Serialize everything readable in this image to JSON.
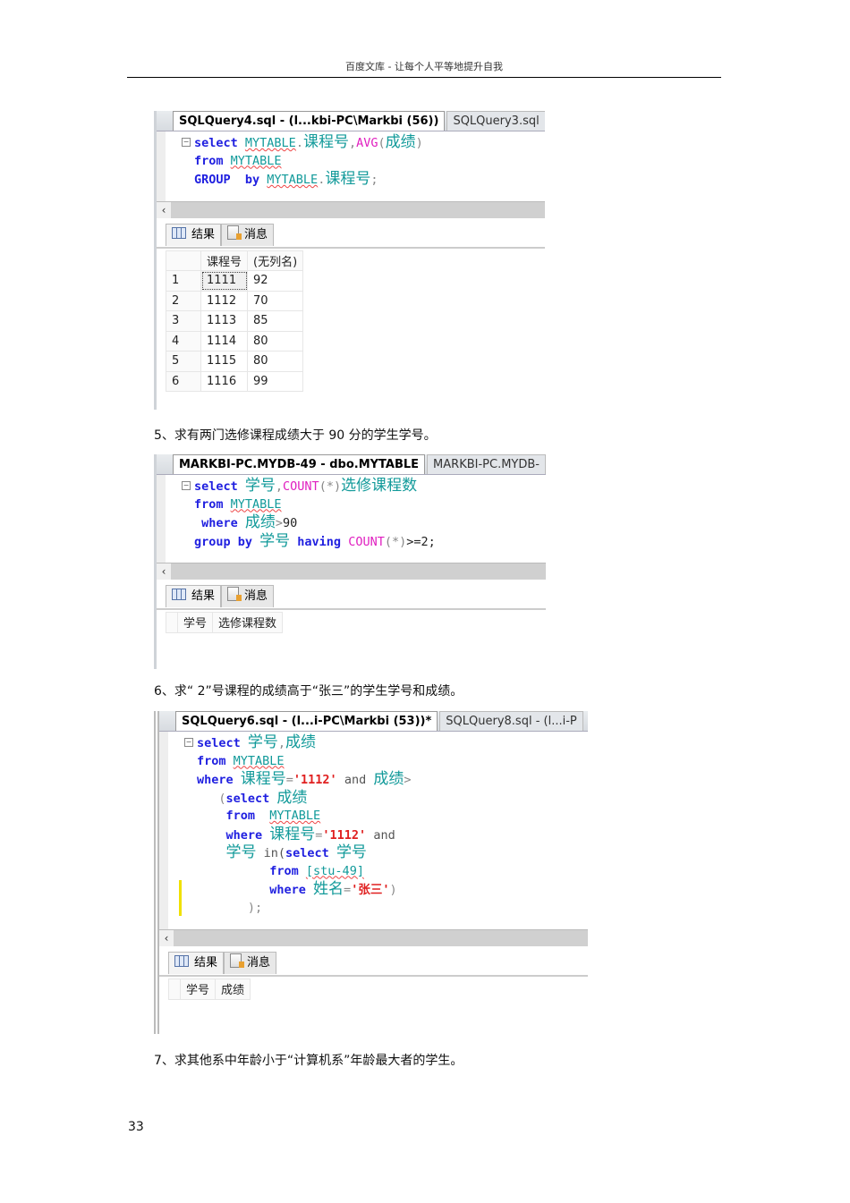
{
  "header": {
    "text": "百度文库  - 让每个人平等地提升自我"
  },
  "page_number": "33",
  "captions": [
    "5、求有两门选修课程成绩大于      90 分的学生学号。",
    "6、求“ 2”号课程的成绩高于“张三”的学生学号和成绩。",
    "7、求其他系中年龄小于“计算机系”年龄最大者的学生。"
  ],
  "shots": [
    {
      "tabs": [
        "SQLQuery4.sql - (l...kbi-PC\\Markbi (56))",
        "SQLQuery3.sql"
      ],
      "code": [
        [
          [
            "kw",
            "select "
          ],
          [
            "id",
            "MYTABLE"
          ],
          [
            "op",
            "."
          ],
          [
            "cn",
            "课程号"
          ],
          [
            "op",
            ","
          ],
          [
            "fn",
            "AVG"
          ],
          [
            "op",
            "("
          ],
          [
            "cn",
            "成绩"
          ],
          [
            "op",
            ")"
          ]
        ],
        [
          [
            "kw",
            "from "
          ],
          [
            "id",
            "MYTABLE"
          ]
        ],
        [
          [
            "kw",
            "GROUP  by "
          ],
          [
            "id",
            "MYTABLE"
          ],
          [
            "op",
            "."
          ],
          [
            "cn",
            "课程号"
          ],
          [
            "op",
            ";"
          ]
        ]
      ],
      "result_tabs": [
        "结果",
        "消息"
      ],
      "columns": [
        "课程号",
        "(无列名)"
      ],
      "rows": [
        [
          "1",
          "1111",
          "92"
        ],
        [
          "2",
          "1112",
          "70"
        ],
        [
          "3",
          "1113",
          "85"
        ],
        [
          "4",
          "1114",
          "80"
        ],
        [
          "5",
          "1115",
          "80"
        ],
        [
          "6",
          "1116",
          "99"
        ]
      ]
    },
    {
      "tabs": [
        "MARKBI-PC.MYDB-49 - dbo.MYTABLE",
        "MARKBI-PC.MYDB-"
      ],
      "code": [
        [
          [
            "kw",
            "select "
          ],
          [
            "cn",
            "学号"
          ],
          [
            "op",
            ","
          ],
          [
            "fn",
            "COUNT"
          ],
          [
            "op",
            "(*)"
          ],
          [
            "cn",
            "选修课程数"
          ]
        ],
        [
          [
            "kw",
            "from "
          ],
          [
            "id",
            "MYTABLE"
          ]
        ],
        [
          [
            "kw",
            " where "
          ],
          [
            "cn",
            "成绩"
          ],
          [
            "op",
            ">"
          ],
          [
            "num",
            "90"
          ]
        ],
        [
          [
            "kw",
            "group by "
          ],
          [
            "cn",
            "学号"
          ],
          [
            "kw",
            " having "
          ],
          [
            "fn",
            "COUNT"
          ],
          [
            "op",
            "(*)"
          ],
          [
            "num",
            ">=2;"
          ]
        ]
      ],
      "result_tabs": [
        "结果",
        "消息"
      ],
      "columns": [
        "学号",
        "选修课程数"
      ],
      "rows": []
    },
    {
      "tabs": [
        "SQLQuery6.sql - (l...i-PC\\Markbi (53))*",
        "SQLQuery8.sql - (l...i-P"
      ],
      "code": [
        [
          [
            "kw",
            "select "
          ],
          [
            "cn",
            "学号"
          ],
          [
            "op",
            ","
          ],
          [
            "cn",
            "成绩"
          ]
        ],
        [
          [
            "kw",
            "from "
          ],
          [
            "id",
            "MYTABLE"
          ]
        ],
        [
          [
            "kw",
            "where "
          ],
          [
            "cn",
            "课程号"
          ],
          [
            "op",
            "="
          ],
          [
            "str",
            "'1112'"
          ],
          [
            "plain",
            " and "
          ],
          [
            "cn",
            "成绩"
          ],
          [
            "op",
            ">"
          ]
        ],
        [
          [
            "op",
            "   ("
          ],
          [
            "kw",
            "select "
          ],
          [
            "cn",
            "成绩"
          ]
        ],
        [
          [
            "kw",
            "    from  "
          ],
          [
            "id",
            "MYTABLE"
          ]
        ],
        [
          [
            "kw",
            "    where "
          ],
          [
            "cn",
            "课程号"
          ],
          [
            "op",
            "="
          ],
          [
            "str",
            "'1112'"
          ],
          [
            "plain",
            " and"
          ]
        ],
        [
          [
            "plain",
            "    "
          ],
          [
            "cn",
            "学号"
          ],
          [
            "plain",
            " in("
          ],
          [
            "kw",
            "select "
          ],
          [
            "cn",
            "学号"
          ]
        ],
        [
          [
            "kw",
            "          from "
          ],
          [
            "id",
            "[stu-49]"
          ]
        ],
        [
          [
            "kw",
            "          where "
          ],
          [
            "cn",
            "姓名"
          ],
          [
            "op",
            "="
          ],
          [
            "str",
            "'张三'"
          ],
          [
            "op",
            ")"
          ]
        ],
        [
          [
            "op",
            "       );"
          ]
        ]
      ],
      "result_tabs": [
        "结果",
        "消息"
      ],
      "columns": [
        "学号",
        "成绩"
      ],
      "rows": []
    }
  ]
}
